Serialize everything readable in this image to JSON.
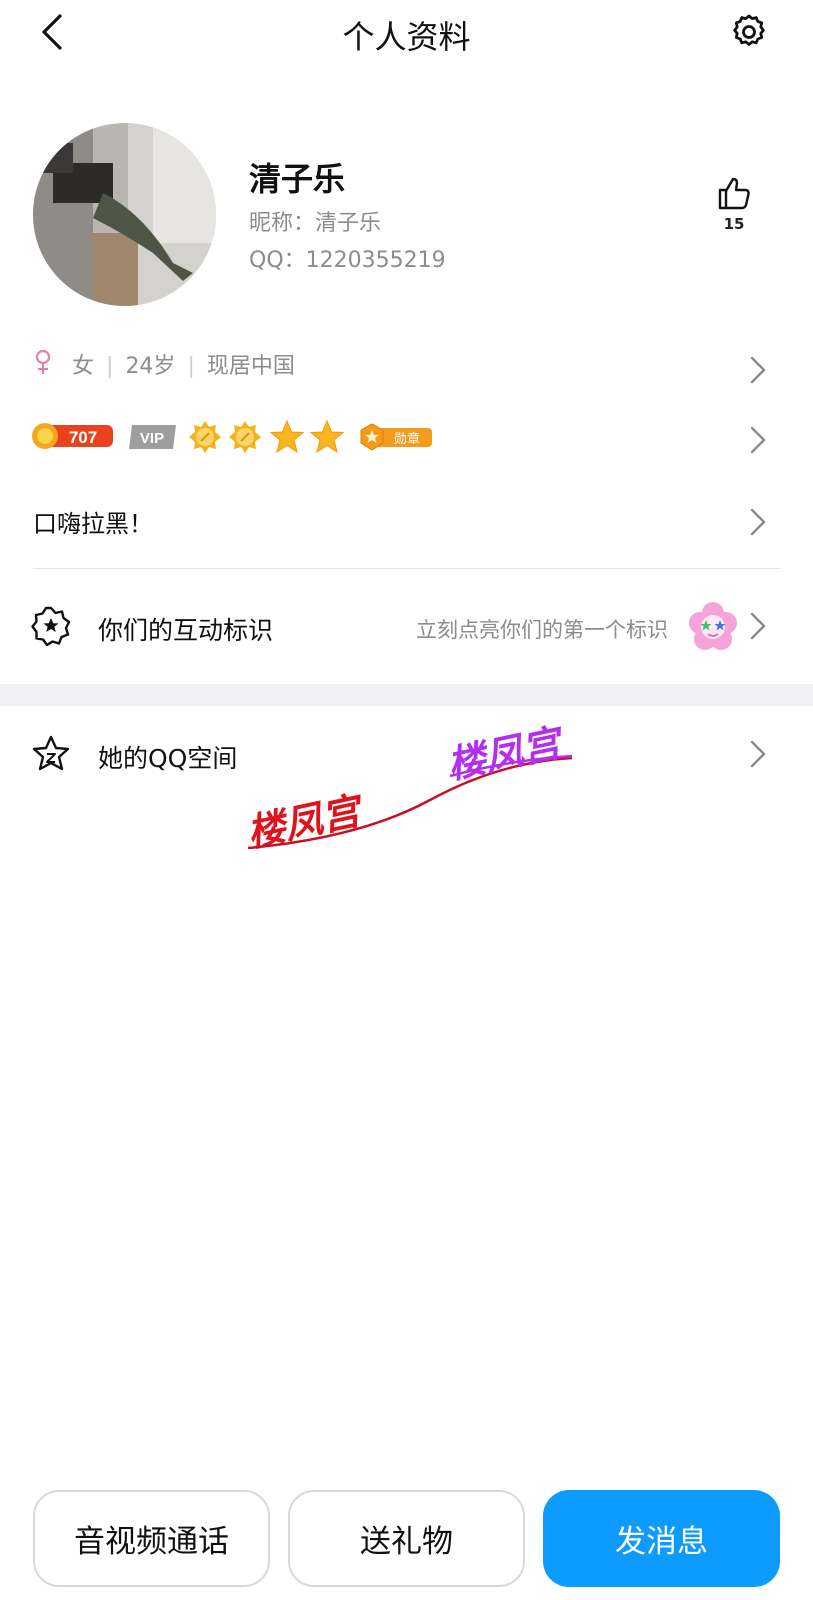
{
  "header": {
    "title": "个人资料",
    "back_icon": "chevron-left-icon",
    "settings_icon": "gear-icon"
  },
  "profile": {
    "display_name": "清子乐",
    "nickname": "昵称：清子乐",
    "qq": "QQ：1220355219",
    "like_icon": "thumbs-up-icon",
    "like_count": "15"
  },
  "info": {
    "gender_icon": "female-icon",
    "gender": "女",
    "age": "24岁",
    "location": "现居中国"
  },
  "badges": {
    "level_value": "707",
    "vip_label": "VIP",
    "medal_label": "勋章"
  },
  "signature": "口嗨拉黑！",
  "interaction": {
    "label": "你们的互动标识",
    "hint": "立刻点亮你们的第一个标识"
  },
  "qzone": {
    "label": "她的QQ空间"
  },
  "watermark": {
    "text_red": "楼凤宫",
    "text_purple": "楼凤宫"
  },
  "actions": {
    "call_label": "音视频通话",
    "gift_label": "送礼物",
    "message_label": "发消息"
  },
  "colors": {
    "primary": "#0d9bff",
    "muted_text": "#8c8c8c",
    "female_pink": "#e57fb0"
  }
}
